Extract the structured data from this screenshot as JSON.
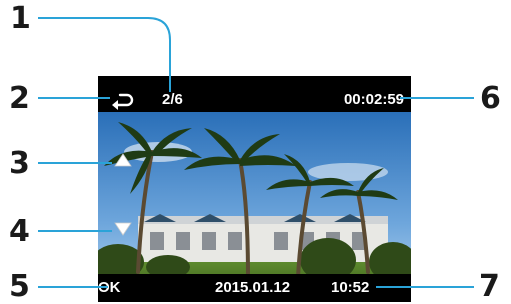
{
  "callouts": {
    "n1": "1",
    "n2": "2",
    "n3": "3",
    "n4": "4",
    "n5": "5",
    "n6": "6",
    "n7": "7"
  },
  "screen": {
    "file_counter": "2/6",
    "video_length": "00:02:59",
    "ok_label": "OK",
    "date": "2015.01.12",
    "time": "10:52"
  },
  "icons": {
    "back": "return-arrow-icon",
    "up": "triangle-up-icon",
    "down": "triangle-down-icon"
  },
  "colors": {
    "screen_bg": "#000000",
    "osd_text": "#ffffff",
    "callout_line": "#2aa3d8",
    "callout_text": "#1a1a1a"
  }
}
